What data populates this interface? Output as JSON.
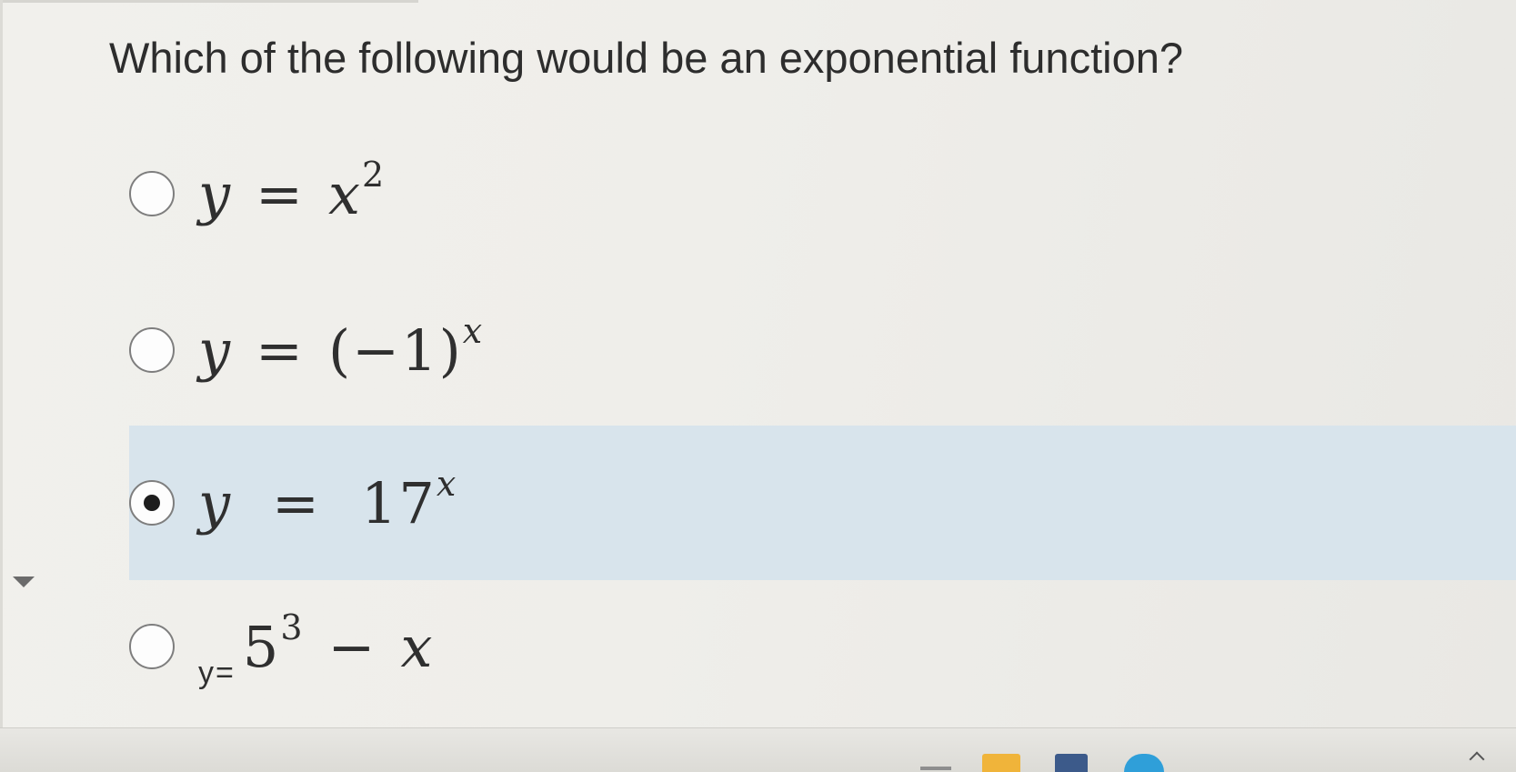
{
  "question": {
    "text": "Which of the following would be an exponential function?"
  },
  "options": [
    {
      "lhs": "y",
      "eq": "=",
      "base": "x",
      "exp": "2",
      "selected": false
    },
    {
      "lhs": "y",
      "eq": "=",
      "base": "(−1)",
      "exp": "x",
      "selected": false
    },
    {
      "lhs": "y",
      "eq": "=",
      "base": "17",
      "exp": "x",
      "selected": true
    },
    {
      "lhs": "y=",
      "base": "5",
      "exp": "3",
      "minus": "−",
      "tail": "x",
      "selected": false
    }
  ],
  "taskbar": {
    "icons": [
      "taskbar-app-icon",
      "folder-icon",
      "store-icon",
      "edge-browser-icon"
    ],
    "tray": "chevron-up-icon"
  },
  "colors": {
    "selected_highlight": "#d8e4ec",
    "background": "#efeeea"
  }
}
